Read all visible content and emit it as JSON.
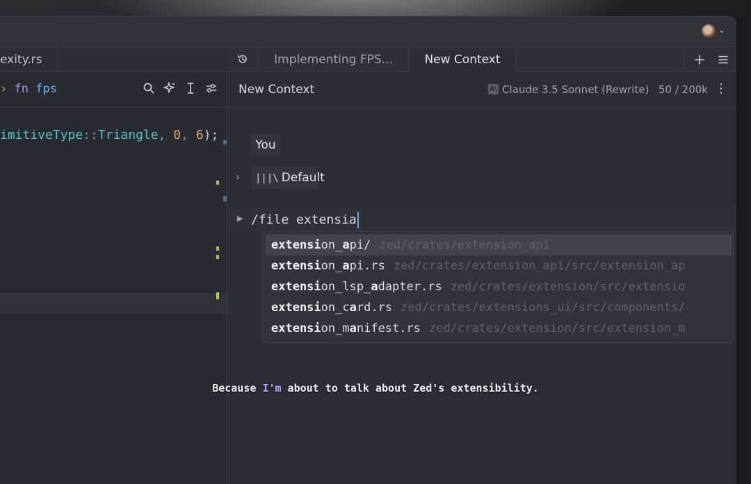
{
  "titlebar": {
    "avatar_chevron": "⌄"
  },
  "left_pane": {
    "tab_label": "exity.rs",
    "breadcrumb": {
      "keyword": "fn",
      "name": "fps",
      "prefix": "›"
    },
    "tool_icons": [
      "search-icon",
      "sparkle-icon",
      "text-cursor-icon",
      "sliders-icon"
    ],
    "code": {
      "part1": "imitiveType",
      "sep": "::",
      "type": "Triangle",
      "comma1": ", ",
      "num1": "0",
      "comma2": ", ",
      "num2": "6",
      "tail": ");"
    }
  },
  "right_pane": {
    "tabs": [
      {
        "label": "Implementing FPS...",
        "active": false
      },
      {
        "label": "New Context",
        "active": true
      }
    ],
    "context": {
      "title": "New Context",
      "model_icon": "A\\",
      "model": "Claude 3.5 Sonnet (Rewrite)",
      "tokens": "50 / 200k"
    },
    "messages": {
      "role": "You",
      "prompt_library": "Default",
      "prompt_library_icon": "|||\\"
    },
    "input": {
      "text": "/file extensia"
    },
    "completions": [
      {
        "match": "extensi",
        "rest_a": "on_",
        "bold2": "a",
        "rest_b": "pi/",
        "path": "zed/crates/extension_api",
        "selected": true
      },
      {
        "match": "extensi",
        "rest_a": "on_",
        "bold2": "a",
        "rest_b": "pi.rs",
        "path": "zed/crates/extension_api/src/extension_ap",
        "selected": false
      },
      {
        "match": "extensi",
        "rest_a": "on_lsp_",
        "bold2": "a",
        "rest_b": "dapter.rs",
        "path": "zed/crates/extension/src/extensio",
        "selected": false
      },
      {
        "match": "extensi",
        "rest_a": "on_c",
        "bold2": "a",
        "rest_b": "rd.rs",
        "path": "zed/crates/extensions_ui/src/components/",
        "selected": false
      },
      {
        "match": "extensi",
        "rest_a": "on_m",
        "bold2": "a",
        "rest_b": "nifest.rs",
        "path": "zed/crates/extension/src/extension_m",
        "selected": false
      }
    ]
  },
  "caption": {
    "before": "Because ",
    "highlight": "I'm",
    "after": " about to talk about Zed's extensibility."
  },
  "colors": {
    "accent": "#6ea3f0",
    "keyword": "#b58df2",
    "function": "#6cb3f2",
    "type": "#58c2c8",
    "number": "#dba86a",
    "caption_highlight": "#c9a5ff"
  }
}
